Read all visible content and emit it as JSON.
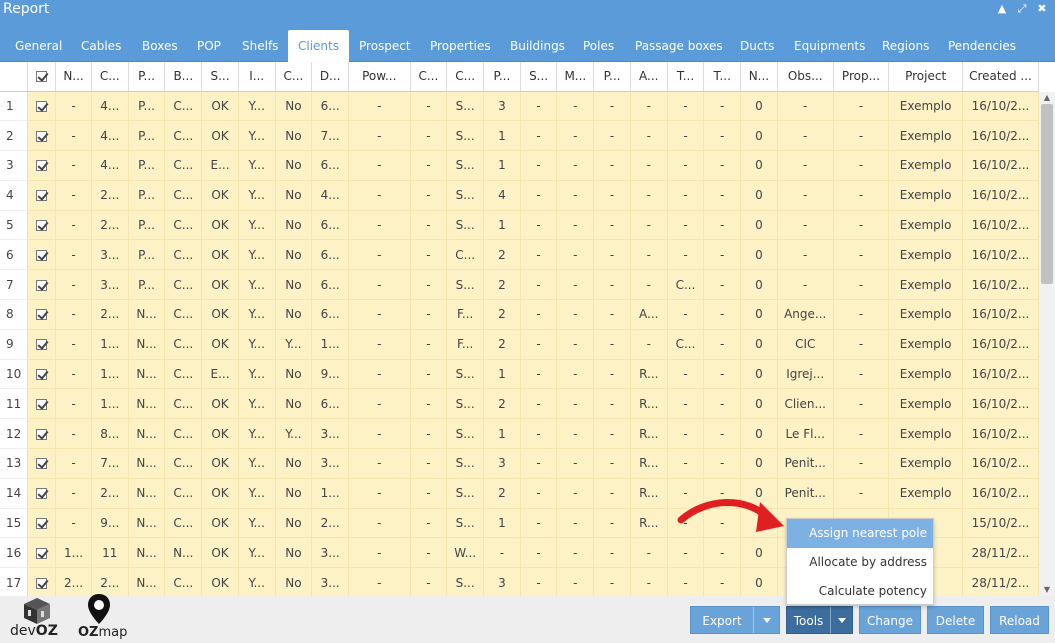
{
  "window": {
    "title": "Report",
    "icons": {
      "pin": "pin-icon",
      "expand": "expand-icon",
      "close": "close-icon"
    }
  },
  "tabs": [
    {
      "label": "General",
      "active": false
    },
    {
      "label": "Cables",
      "active": false
    },
    {
      "label": "Boxes",
      "active": false
    },
    {
      "label": "POP",
      "active": false
    },
    {
      "label": "Shelfs",
      "active": false
    },
    {
      "label": "Clients",
      "active": true
    },
    {
      "label": "Prospect",
      "active": false
    },
    {
      "label": "Properties",
      "active": false
    },
    {
      "label": "Buildings",
      "active": false
    },
    {
      "label": "Poles",
      "active": false
    },
    {
      "label": "Passage boxes",
      "active": false
    },
    {
      "label": "Ducts",
      "active": false
    },
    {
      "label": "Equipments",
      "active": false
    },
    {
      "label": "Regions",
      "active": false
    },
    {
      "label": "Pendencies",
      "active": false
    }
  ],
  "table": {
    "columns": [
      "N...",
      "C...",
      "P...",
      "B...",
      "S...",
      "I...",
      "C...",
      "D...",
      "Pow...",
      "C...",
      "C...",
      "P...",
      "S...",
      "M...",
      "P...",
      "A...",
      "T...",
      "T...",
      "N...",
      "Obs...",
      "Prop...",
      "Project",
      "Created ..."
    ],
    "rows": [
      {
        "num": "1",
        "cells": [
          "-",
          "4...",
          "P...",
          "C...",
          "OK",
          "Y...",
          "No",
          "6...",
          "-",
          "-",
          "S...",
          "3",
          "-",
          "-",
          "-",
          "-",
          "-",
          "-",
          "0",
          "-",
          "-",
          "Exemplo",
          "16/10/2..."
        ]
      },
      {
        "num": "2",
        "cells": [
          "-",
          "4...",
          "P...",
          "C...",
          "OK",
          "Y...",
          "No",
          "7...",
          "-",
          "-",
          "S...",
          "1",
          "-",
          "-",
          "-",
          "-",
          "-",
          "-",
          "0",
          "-",
          "-",
          "Exemplo",
          "16/10/2..."
        ]
      },
      {
        "num": "3",
        "cells": [
          "-",
          "4...",
          "P...",
          "C...",
          "E...",
          "Y...",
          "No",
          "6...",
          "-",
          "-",
          "S...",
          "1",
          "-",
          "-",
          "-",
          "-",
          "-",
          "-",
          "0",
          "-",
          "-",
          "Exemplo",
          "16/10/2..."
        ]
      },
      {
        "num": "4",
        "cells": [
          "-",
          "2...",
          "P...",
          "C...",
          "OK",
          "Y...",
          "No",
          "4...",
          "-",
          "-",
          "S...",
          "4",
          "-",
          "-",
          "-",
          "-",
          "-",
          "-",
          "0",
          "-",
          "-",
          "Exemplo",
          "16/10/2..."
        ]
      },
      {
        "num": "5",
        "cells": [
          "-",
          "2...",
          "P...",
          "C...",
          "OK",
          "Y...",
          "No",
          "6...",
          "-",
          "-",
          "S...",
          "1",
          "-",
          "-",
          "-",
          "-",
          "-",
          "-",
          "0",
          "-",
          "-",
          "Exemplo",
          "16/10/2..."
        ]
      },
      {
        "num": "6",
        "cells": [
          "-",
          "3...",
          "P...",
          "C...",
          "OK",
          "Y...",
          "No",
          "6...",
          "-",
          "-",
          "C...",
          "2",
          "-",
          "-",
          "-",
          "-",
          "-",
          "-",
          "0",
          "-",
          "-",
          "Exemplo",
          "16/10/2..."
        ]
      },
      {
        "num": "7",
        "cells": [
          "-",
          "3...",
          "P...",
          "C...",
          "OK",
          "Y...",
          "No",
          "6...",
          "-",
          "-",
          "S...",
          "2",
          "-",
          "-",
          "-",
          "-",
          "C...",
          "-",
          "0",
          "-",
          "-",
          "Exemplo",
          "16/10/2..."
        ]
      },
      {
        "num": "8",
        "cells": [
          "-",
          "2...",
          "N...",
          "C...",
          "OK",
          "Y...",
          "No",
          "6...",
          "-",
          "-",
          "F...",
          "2",
          "-",
          "-",
          "-",
          "A...",
          "-",
          "-",
          "0",
          "Ange...",
          "-",
          "Exemplo",
          "16/10/2..."
        ]
      },
      {
        "num": "9",
        "cells": [
          "-",
          "1...",
          "N...",
          "C...",
          "OK",
          "Y...",
          "Y...",
          "1...",
          "-",
          "-",
          "F...",
          "2",
          "-",
          "-",
          "-",
          "-",
          "C...",
          "-",
          "0",
          "CIC",
          "-",
          "Exemplo",
          "16/10/2..."
        ]
      },
      {
        "num": "10",
        "cells": [
          "-",
          "1...",
          "N...",
          "C...",
          "E...",
          "Y...",
          "No",
          "9...",
          "-",
          "-",
          "S...",
          "1",
          "-",
          "-",
          "-",
          "R...",
          "-",
          "-",
          "0",
          "Igrej...",
          "-",
          "Exemplo",
          "16/10/2..."
        ]
      },
      {
        "num": "11",
        "cells": [
          "-",
          "1...",
          "N...",
          "C...",
          "OK",
          "Y...",
          "No",
          "6...",
          "-",
          "-",
          "S...",
          "2",
          "-",
          "-",
          "-",
          "R...",
          "-",
          "-",
          "0",
          "Clien...",
          "-",
          "Exemplo",
          "16/10/2..."
        ]
      },
      {
        "num": "12",
        "cells": [
          "-",
          "8...",
          "N...",
          "C...",
          "OK",
          "Y...",
          "Y...",
          "3...",
          "-",
          "-",
          "S...",
          "1",
          "-",
          "-",
          "-",
          "R...",
          "-",
          "-",
          "0",
          "Le Fl...",
          "-",
          "Exemplo",
          "16/10/2..."
        ]
      },
      {
        "num": "13",
        "cells": [
          "-",
          "7...",
          "N...",
          "C...",
          "OK",
          "Y...",
          "No",
          "3...",
          "-",
          "-",
          "S...",
          "3",
          "-",
          "-",
          "-",
          "R...",
          "-",
          "-",
          "0",
          "Penit...",
          "-",
          "Exemplo",
          "16/10/2..."
        ]
      },
      {
        "num": "14",
        "cells": [
          "-",
          "2...",
          "N...",
          "C...",
          "OK",
          "Y...",
          "No",
          "1...",
          "-",
          "-",
          "S...",
          "2",
          "-",
          "-",
          "-",
          "R...",
          "-",
          "-",
          "0",
          "Penit...",
          "-",
          "Exemplo",
          "16/10/2..."
        ]
      },
      {
        "num": "15",
        "cells": [
          "-",
          "9...",
          "N...",
          "C...",
          "OK",
          "Y...",
          "No",
          "2...",
          "-",
          "-",
          "S...",
          "1",
          "-",
          "-",
          "-",
          "R...",
          "-",
          "-",
          "",
          "",
          "",
          "",
          "15/10/2..."
        ]
      },
      {
        "num": "16",
        "cells": [
          "1...",
          "11",
          "N...",
          "N...",
          "OK",
          "Y...",
          "No",
          "3...",
          "-",
          "-",
          "W...",
          "-",
          "-",
          "-",
          "-",
          "-",
          "-",
          "-",
          "0",
          "",
          "",
          "",
          "28/11/2..."
        ]
      },
      {
        "num": "17",
        "cells": [
          "2...",
          "2...",
          "N...",
          "C...",
          "OK",
          "Y...",
          "No",
          "3...",
          "-",
          "-",
          "S...",
          "3",
          "-",
          "-",
          "-",
          "-",
          "-",
          "-",
          "0",
          "",
          "",
          "",
          "28/11/2..."
        ]
      }
    ]
  },
  "tools_menu": {
    "items": [
      "Assign nearest pole",
      "Allocate by address",
      "Calculate potency"
    ],
    "highlighted": 0
  },
  "buttons": {
    "export": "Export",
    "tools": "Tools",
    "change": "Change",
    "delete": "Delete",
    "reload": "Reload"
  },
  "logos": {
    "devoz_prefix": "dev",
    "devoz_suffix": "OZ",
    "ozmap_prefix": "OZ",
    "ozmap_suffix": "map"
  },
  "colors": {
    "accent": "#5b9bd9",
    "row_bg": "#fdf1c6",
    "tools_button": "#3b6e9e",
    "arrow": "#e02020"
  }
}
